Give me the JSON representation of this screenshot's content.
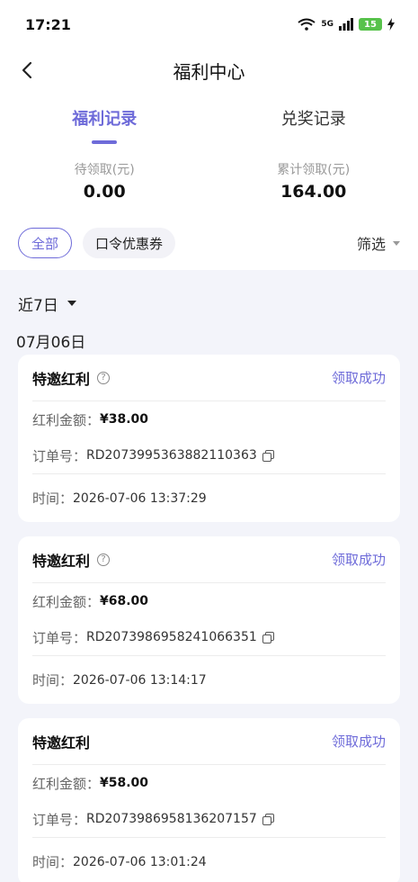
{
  "status_bar": {
    "time": "17:21",
    "signal_label": "5G",
    "battery_level": "15"
  },
  "nav": {
    "title": "福利中心"
  },
  "tabs": [
    {
      "label": "福利记录",
      "active": true
    },
    {
      "label": "兑奖记录",
      "active": false
    }
  ],
  "summary": {
    "pending_label": "待领取(元)",
    "pending_value": "0.00",
    "total_label": "累计领取(元)",
    "total_value": "164.00"
  },
  "filters": {
    "chips": [
      "全部",
      "口令优惠券"
    ],
    "filter_label": "筛选"
  },
  "range_label": "近7日",
  "date_group": "07月06日",
  "labels": {
    "amount": "红利金额：",
    "order": "订单号：",
    "time": "时间："
  },
  "records": [
    {
      "title": "特邀红利",
      "has_info": true,
      "status": "领取成功",
      "amount": "¥38.00",
      "order_no": "RD2073995363882110363",
      "time": "2026-07-06 13:37:29"
    },
    {
      "title": "特邀红利",
      "has_info": true,
      "status": "领取成功",
      "amount": "¥68.00",
      "order_no": "RD2073986958241066351",
      "time": "2026-07-06 13:14:17"
    },
    {
      "title": "特邀红利",
      "has_info": false,
      "status": "领取成功",
      "amount": "¥58.00",
      "order_no": "RD2073986958136207157",
      "time": "2026-07-06 13:01:24"
    }
  ],
  "colors": {
    "accent": "#6e6bd9",
    "background": "#f3f4fa"
  }
}
